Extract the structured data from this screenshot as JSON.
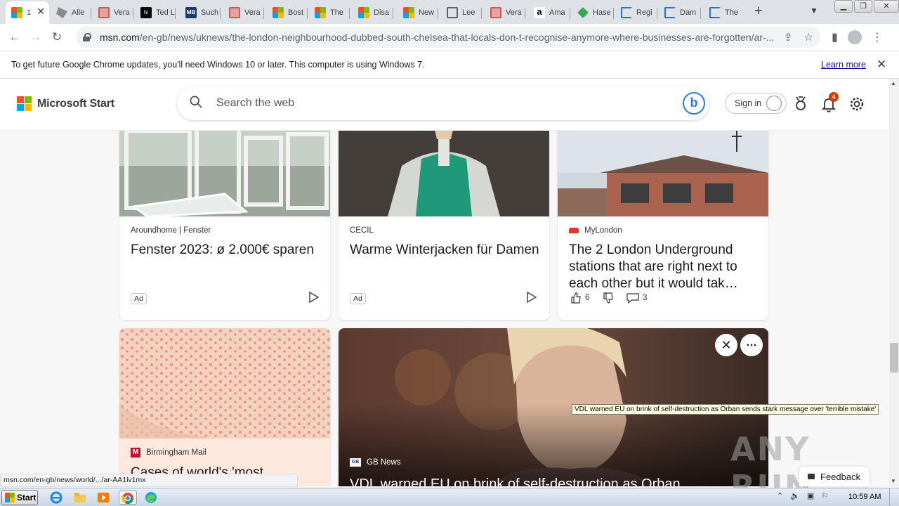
{
  "browser": {
    "tabs": [
      {
        "title": "1",
        "icon": "microsoft-icon",
        "active": true
      },
      {
        "title": "Alle",
        "icon": "generic-icon"
      },
      {
        "title": "Vera",
        "icon": "vera-icon"
      },
      {
        "title": "Ted L",
        "icon": "appletv-icon"
      },
      {
        "title": "Such",
        "icon": "mb-icon"
      },
      {
        "title": "Vera",
        "icon": "vera-icon"
      },
      {
        "title": "Bost",
        "icon": "microsoft-icon"
      },
      {
        "title": "The",
        "icon": "microsoft-icon"
      },
      {
        "title": "Disa",
        "icon": "microsoft-icon"
      },
      {
        "title": "New",
        "icon": "microsoft-icon"
      },
      {
        "title": "Lee",
        "icon": "globe-icon"
      },
      {
        "title": "Vera",
        "icon": "vera-icon"
      },
      {
        "title": "Ama",
        "icon": "amazon-icon"
      },
      {
        "title": "Hase",
        "icon": "tag-icon"
      },
      {
        "title": "Regi",
        "icon": "loading-icon"
      },
      {
        "title": "Dam",
        "icon": "loading-icon"
      },
      {
        "title": "The",
        "icon": "loading-icon"
      }
    ],
    "new_tab_label": "+",
    "url_host": "msn.com",
    "url_path": "/en-gb/news/uknews/the-london-neighbourhood-dubbed-south-chelsea-that-locals-don-t-recognise-anymore-where-businesses-are-forgotten/ar-...",
    "infobar": {
      "message": "To get future Google Chrome updates, you'll need Windows 10 or later. This computer is using Windows 7.",
      "link": "Learn more"
    },
    "status_url": "msn.com/en-gb/news/world/.../ar-AA1lv1mx",
    "tooltip": "VDL warned EU on brink of self-destruction as Orban sends stark message over 'terrible mistake'"
  },
  "msn": {
    "brand": "Microsoft Start",
    "search_placeholder": "Search the web",
    "sign_in": "Sign in",
    "notification_count": "4",
    "feedback": "Feedback"
  },
  "cards": [
    {
      "source": "Aroundhome | Fenster",
      "title": "Fenster 2023: ø 2.000€ sparen",
      "badge": "Ad"
    },
    {
      "source": "CECIL",
      "title": "Warme Winterjacken für Damen",
      "badge": "Ad"
    },
    {
      "source": "MyLondon",
      "title": "The 2 London Underground stations that are right next to each other but it would tak…",
      "likes": "6",
      "comments": "3"
    },
    {
      "source": "Birmingham Mail",
      "title": "Cases of world's 'most"
    },
    {
      "source": "GB News",
      "title": "VDL warned EU on brink of self-destruction as Orban"
    }
  ],
  "taskbar": {
    "start": "Start",
    "clock": "10:59 AM"
  },
  "watermark": "ANY RUN",
  "colors": {
    "ms_red": "#f25022",
    "ms_green": "#7fba00",
    "ms_blue": "#00a4ef",
    "ms_yellow": "#ffb900",
    "link": "#1a0dab",
    "badge": "#d83b01"
  }
}
